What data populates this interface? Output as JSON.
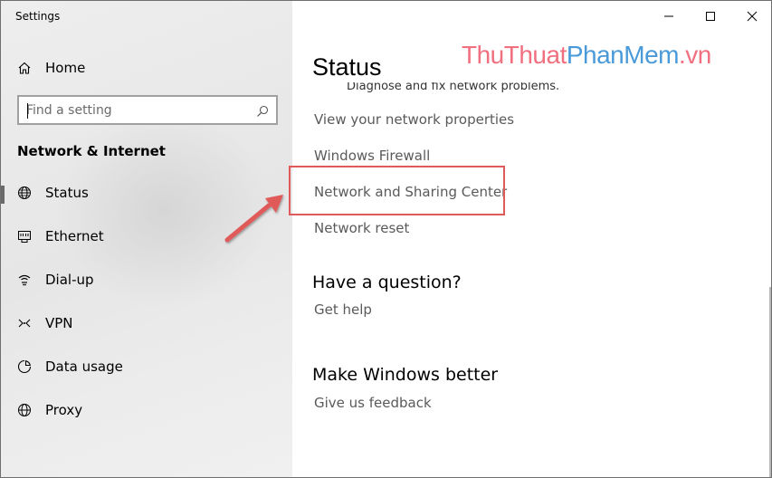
{
  "window": {
    "title": "Settings",
    "controls": {
      "minimize": "minimize-icon",
      "maximize": "maximize-icon",
      "close": "close-icon"
    }
  },
  "sidebar": {
    "home_label": "Home",
    "search_placeholder": "Find a setting",
    "section_title": "Network & Internet",
    "items": [
      {
        "label": "Status",
        "icon": "globe-icon",
        "active": true
      },
      {
        "label": "Ethernet",
        "icon": "ethernet-icon",
        "active": false
      },
      {
        "label": "Dial-up",
        "icon": "dialup-icon",
        "active": false
      },
      {
        "label": "VPN",
        "icon": "vpn-icon",
        "active": false
      },
      {
        "label": "Data usage",
        "icon": "data-usage-icon",
        "active": false
      },
      {
        "label": "Proxy",
        "icon": "globe-icon",
        "active": false
      }
    ]
  },
  "main": {
    "title": "Status",
    "clipped_description": "Diagnose and fix network problems.",
    "links": [
      {
        "label": "View your network properties"
      },
      {
        "label": "Windows Firewall"
      },
      {
        "label": "Network and Sharing Center",
        "highlighted": true
      },
      {
        "label": "Network reset"
      }
    ],
    "question": {
      "heading": "Have a question?",
      "link": "Get help"
    },
    "feedback": {
      "heading": "Make Windows better",
      "link": "Give us feedback"
    }
  },
  "watermark": {
    "part1": "ThuThuat",
    "part2": "PhanMem",
    "part3": ".vn"
  },
  "colors": {
    "highlight_border": "#e05a5a",
    "arrow": "#e05a5a",
    "sidebar_bg": "#ebebeb",
    "link_text": "#5a5a5a"
  }
}
